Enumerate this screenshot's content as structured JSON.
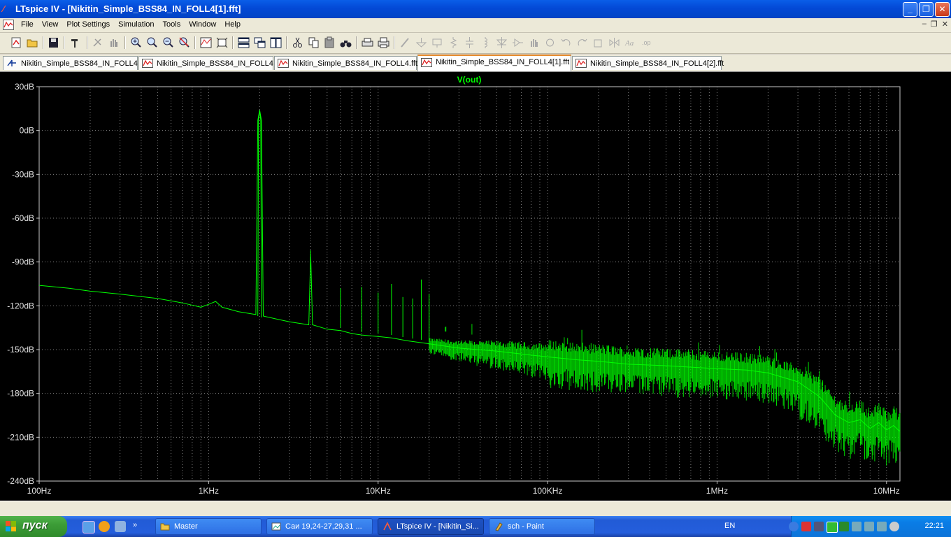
{
  "window": {
    "title": "LTspice IV - [Nikitin_Simple_BSS84_IN_FOLL4[1].fft]"
  },
  "menu": [
    "File",
    "View",
    "Plot Settings",
    "Simulation",
    "Tools",
    "Window",
    "Help"
  ],
  "tabs": [
    {
      "label": "Nikitin_Simple_BSS84_IN_FOLL4",
      "icon": "schematic-icon"
    },
    {
      "label": "Nikitin_Simple_BSS84_IN_FOLL4",
      "icon": "waveform-icon"
    },
    {
      "label": "Nikitin_Simple_BSS84_IN_FOLL4.fft",
      "icon": "waveform-icon"
    },
    {
      "label": "Nikitin_Simple_BSS84_IN_FOLL4[1].fft",
      "icon": "waveform-icon",
      "active": true
    },
    {
      "label": "Nikitin_Simple_BSS84_IN_FOLL4[2].fft",
      "icon": "waveform-icon"
    }
  ],
  "chart_data": {
    "type": "line",
    "title": "V(out)",
    "x_scale": "log",
    "xlim": [
      100,
      12000000
    ],
    "ylim": [
      -240,
      30
    ],
    "x_ticks": [
      {
        "value": 100,
        "label": "100Hz"
      },
      {
        "value": 1000,
        "label": "1KHz"
      },
      {
        "value": 10000,
        "label": "10KHz"
      },
      {
        "value": 100000,
        "label": "100KHz"
      },
      {
        "value": 1000000,
        "label": "1MHz"
      },
      {
        "value": 10000000,
        "label": "10MHz"
      }
    ],
    "y_ticks": [
      {
        "value": 30,
        "label": "30dB"
      },
      {
        "value": 0,
        "label": "0dB"
      },
      {
        "value": -30,
        "label": "-30dB"
      },
      {
        "value": -60,
        "label": "-60dB"
      },
      {
        "value": -90,
        "label": "-90dB"
      },
      {
        "value": -120,
        "label": "-120dB"
      },
      {
        "value": -150,
        "label": "-150dB"
      },
      {
        "value": -180,
        "label": "-180dB"
      },
      {
        "value": -210,
        "label": "-210dB"
      },
      {
        "value": -240,
        "label": "-240dB"
      }
    ],
    "grid": true,
    "series": [
      {
        "name": "V(out)",
        "color": "#00ff00",
        "x": [
          100,
          150,
          200,
          300,
          500,
          700,
          900,
          1000,
          1100,
          1200,
          1500,
          1900,
          1950,
          2000,
          2050,
          2100,
          2500,
          3000,
          3900,
          4000,
          4100,
          5000,
          6000,
          7000,
          8000,
          10000,
          12000,
          15000,
          20000,
          30000,
          50000,
          70000,
          100000,
          150000,
          200000,
          300000,
          500000,
          700000,
          1000000,
          1500000,
          2000000,
          3000000,
          4000000,
          5000000,
          6000000,
          7000000,
          8000000,
          9000000,
          10000000,
          11000000,
          12000000
        ],
        "y": [
          -106,
          -108,
          -110,
          -112,
          -115,
          -118,
          -121,
          -119,
          -117,
          -121,
          -124,
          -126,
          7,
          14,
          7,
          -127,
          -129,
          -131,
          -133,
          -84,
          -133,
          -136,
          -137,
          -139,
          -140,
          -141,
          -142,
          -144,
          -146,
          -149,
          -151,
          -153,
          -155,
          -157,
          -158,
          -160,
          -161,
          -162,
          -163,
          -164,
          -166,
          -172,
          -182,
          -195,
          -200,
          -198,
          -204,
          -200,
          -205,
          -202,
          -206
        ]
      }
    ],
    "harmonic_peaks": [
      {
        "x": 2000,
        "y": 14
      },
      {
        "x": 4000,
        "y": -84
      },
      {
        "x": 6000,
        "y": -108
      },
      {
        "x": 8000,
        "y": -107
      },
      {
        "x": 10000,
        "y": -111
      },
      {
        "x": 12000,
        "y": -105
      },
      {
        "x": 14000,
        "y": -114
      },
      {
        "x": 16000,
        "y": -115
      },
      {
        "x": 18000,
        "y": -102
      },
      {
        "x": 20000,
        "y": -112
      }
    ]
  },
  "taskbar": {
    "start_label": "пуск",
    "tasks": [
      {
        "label": "Master"
      },
      {
        "label": "Саи 19,24-27,29,31 ..."
      },
      {
        "label": "LTspice IV - [Nikitin_Si...",
        "active": true
      },
      {
        "label": "sch - Paint"
      }
    ],
    "lang": "EN",
    "clock": "22:21"
  }
}
